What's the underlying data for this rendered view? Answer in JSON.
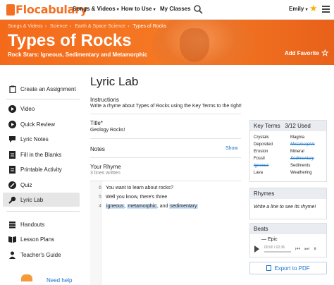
{
  "nav": {
    "logo": "Flocabulary",
    "links": [
      {
        "label": "Songs & Videos",
        "caret": "▾"
      },
      {
        "label": "How to Use",
        "caret": "▾"
      },
      {
        "label": "My Classes",
        "caret": ""
      }
    ],
    "user": "Emily",
    "user_caret": "▾",
    "search_icon": "search-icon",
    "star_icon": "star-icon",
    "menu_icon": "hamburger-menu-icon"
  },
  "hero": {
    "breadcrumbs": [
      "Songs & Videos",
      "Science",
      "Earth & Space Science",
      "Types of Rocks"
    ],
    "title": "Types of Rocks",
    "subtitle": "Rock Stars: Igneous, Sedimentary and Metamorphic",
    "add_favorite": "Add Favorite",
    "favorite_glyph": "☆"
  },
  "sidebar": {
    "items": [
      {
        "label": "Create an Assignment",
        "icon": "clipboard-icon",
        "active": false
      },
      {
        "label": "Video",
        "icon": "play-icon",
        "active": false
      },
      {
        "label": "Quick Review",
        "icon": "play-icon",
        "active": false
      },
      {
        "label": "Lyric Notes",
        "icon": "chat-icon",
        "active": false
      },
      {
        "label": "Fill in the Blanks",
        "icon": "document-icon",
        "active": false
      },
      {
        "label": "Printable Activity",
        "icon": "document-icon",
        "active": false
      },
      {
        "label": "Quiz",
        "icon": "pencil-icon",
        "active": false
      },
      {
        "label": "Lyric Lab",
        "icon": "microphone-icon",
        "active": true
      },
      {
        "label": "Handouts",
        "icon": "stack-icon",
        "active": false
      },
      {
        "label": "Lesson Plans",
        "icon": "book-icon",
        "active": false
      },
      {
        "label": "Teacher's Guide",
        "icon": "person-icon",
        "active": false
      }
    ],
    "need_help": "Need help"
  },
  "main": {
    "title": "Lyric Lab",
    "instructions_label": "Instructions",
    "instructions_text": "Write a rhyme about Types of Rocks using the Key Terms to the right!",
    "title_label": "Title*",
    "title_value": "Geology Rocks!",
    "notes_label": "Notes",
    "notes_show": "Show",
    "rhyme_label": "Your Rhyme",
    "rhyme_sub": "3 lines written",
    "lines": [
      {
        "num": "6",
        "parts": [
          {
            "text": "You want to learn about rocks?",
            "hl": false
          }
        ]
      },
      {
        "num": "5",
        "parts": [
          {
            "text": "Well you know, there's three",
            "hl": false
          }
        ]
      },
      {
        "num": "4",
        "parts": [
          {
            "text": "igneous",
            "hl": true
          },
          {
            "text": ", ",
            "hl": false
          },
          {
            "text": "metamorphic",
            "hl": true
          },
          {
            "text": ", and ",
            "hl": false
          },
          {
            "text": "sedimentary",
            "hl": true
          }
        ]
      }
    ]
  },
  "key_terms": {
    "label": "Key Terms",
    "used": "3/12 Used",
    "col1": [
      {
        "term": "Crystals",
        "used": false
      },
      {
        "term": "Deposited",
        "used": false
      },
      {
        "term": "Erosion",
        "used": false
      },
      {
        "term": "Fossil",
        "used": false
      },
      {
        "term": "Igneous",
        "used": true
      },
      {
        "term": "Lava",
        "used": false
      }
    ],
    "col2": [
      {
        "term": "Magma",
        "used": false
      },
      {
        "term": "Metamorphic",
        "used": true
      },
      {
        "term": "Mineral",
        "used": false
      },
      {
        "term": "Sedimentary",
        "used": true
      },
      {
        "term": "Sediments",
        "used": false
      },
      {
        "term": "Weathering",
        "used": false
      }
    ]
  },
  "rhymes": {
    "label": "Rhymes",
    "prompt": "Write a line to see its rhyme!"
  },
  "beats": {
    "label": "Beats",
    "selected": "Epic",
    "selected_prefix": "— ",
    "time": "00:00 / 02:36",
    "controls": [
      "⏮",
      "⏭",
      "⏸"
    ]
  },
  "export": {
    "label": "Export to PDF"
  },
  "colors": {
    "brand": "#f36f21",
    "link": "#1a73c9",
    "highlight": "#cfe3f7"
  }
}
